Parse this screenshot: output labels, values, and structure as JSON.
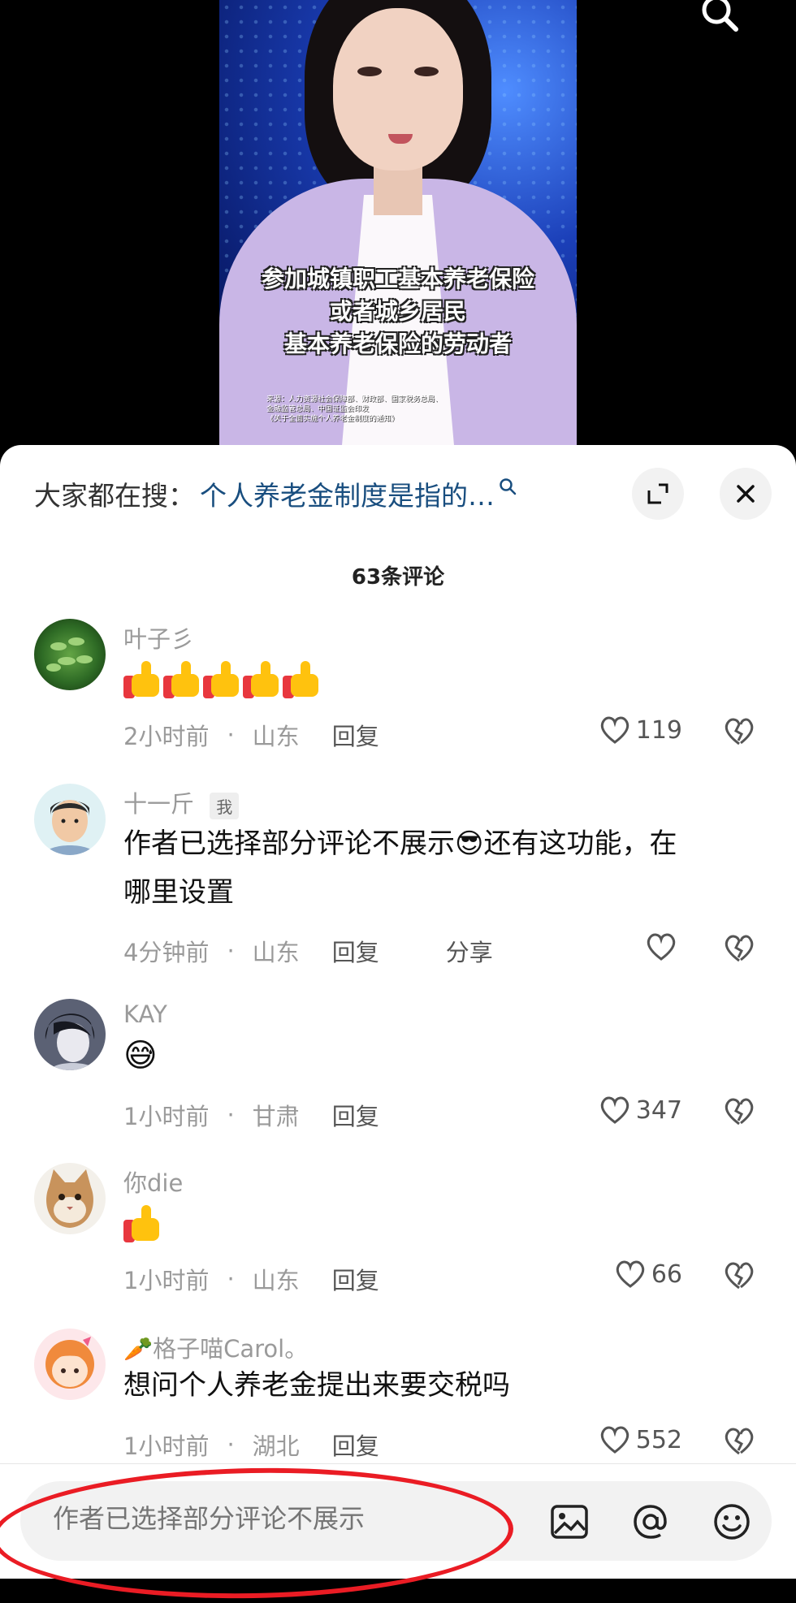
{
  "video": {
    "subtitle_lines": [
      "参加城镇职工基本养老保险",
      "或者城乡居民",
      "基本养老保险的劳动者"
    ],
    "caption_lines": [
      "来源：人力资源社会保障部、财政部、国家税务总局、",
      "金融监管总局、中国证监会印发",
      "《关于全面实施个人养老金制度的通知》"
    ]
  },
  "search": {
    "prefix": "大家都在搜：",
    "query": "个人养老金制度是指的…"
  },
  "comments_count": "63条评论",
  "comments": [
    {
      "username": "叶子彡",
      "emoji": "👍👍👍👍👍",
      "time": "2小时前",
      "location": "山东",
      "reply": "回复",
      "likes": "119"
    },
    {
      "username": "十一斤",
      "tag": "我",
      "text_line1": "作者已选择部分评论不展示😎还有这功能，在",
      "text_line2": "哪里设置",
      "time": "4分钟前",
      "location": "山东",
      "reply": "回复",
      "share": "分享"
    },
    {
      "username": "KAY",
      "emoji": "😅",
      "time": "1小时前",
      "location": "甘肃",
      "reply": "回复",
      "likes": "347"
    },
    {
      "username": "你die",
      "emoji": "👍",
      "time": "1小时前",
      "location": "山东",
      "reply": "回复",
      "likes": "66"
    },
    {
      "username": "🥕格子喵Carol。",
      "text": "想问个人养老金提出来要交税吗",
      "time": "1小时前",
      "location": "湖北",
      "reply": "回复",
      "likes": "552"
    }
  ],
  "input": {
    "placeholder": "作者已选择部分评论不展示"
  },
  "colors": {
    "link": "#194e7f",
    "highlight": "#ea1c24",
    "jacket": "#c9b6e6"
  }
}
